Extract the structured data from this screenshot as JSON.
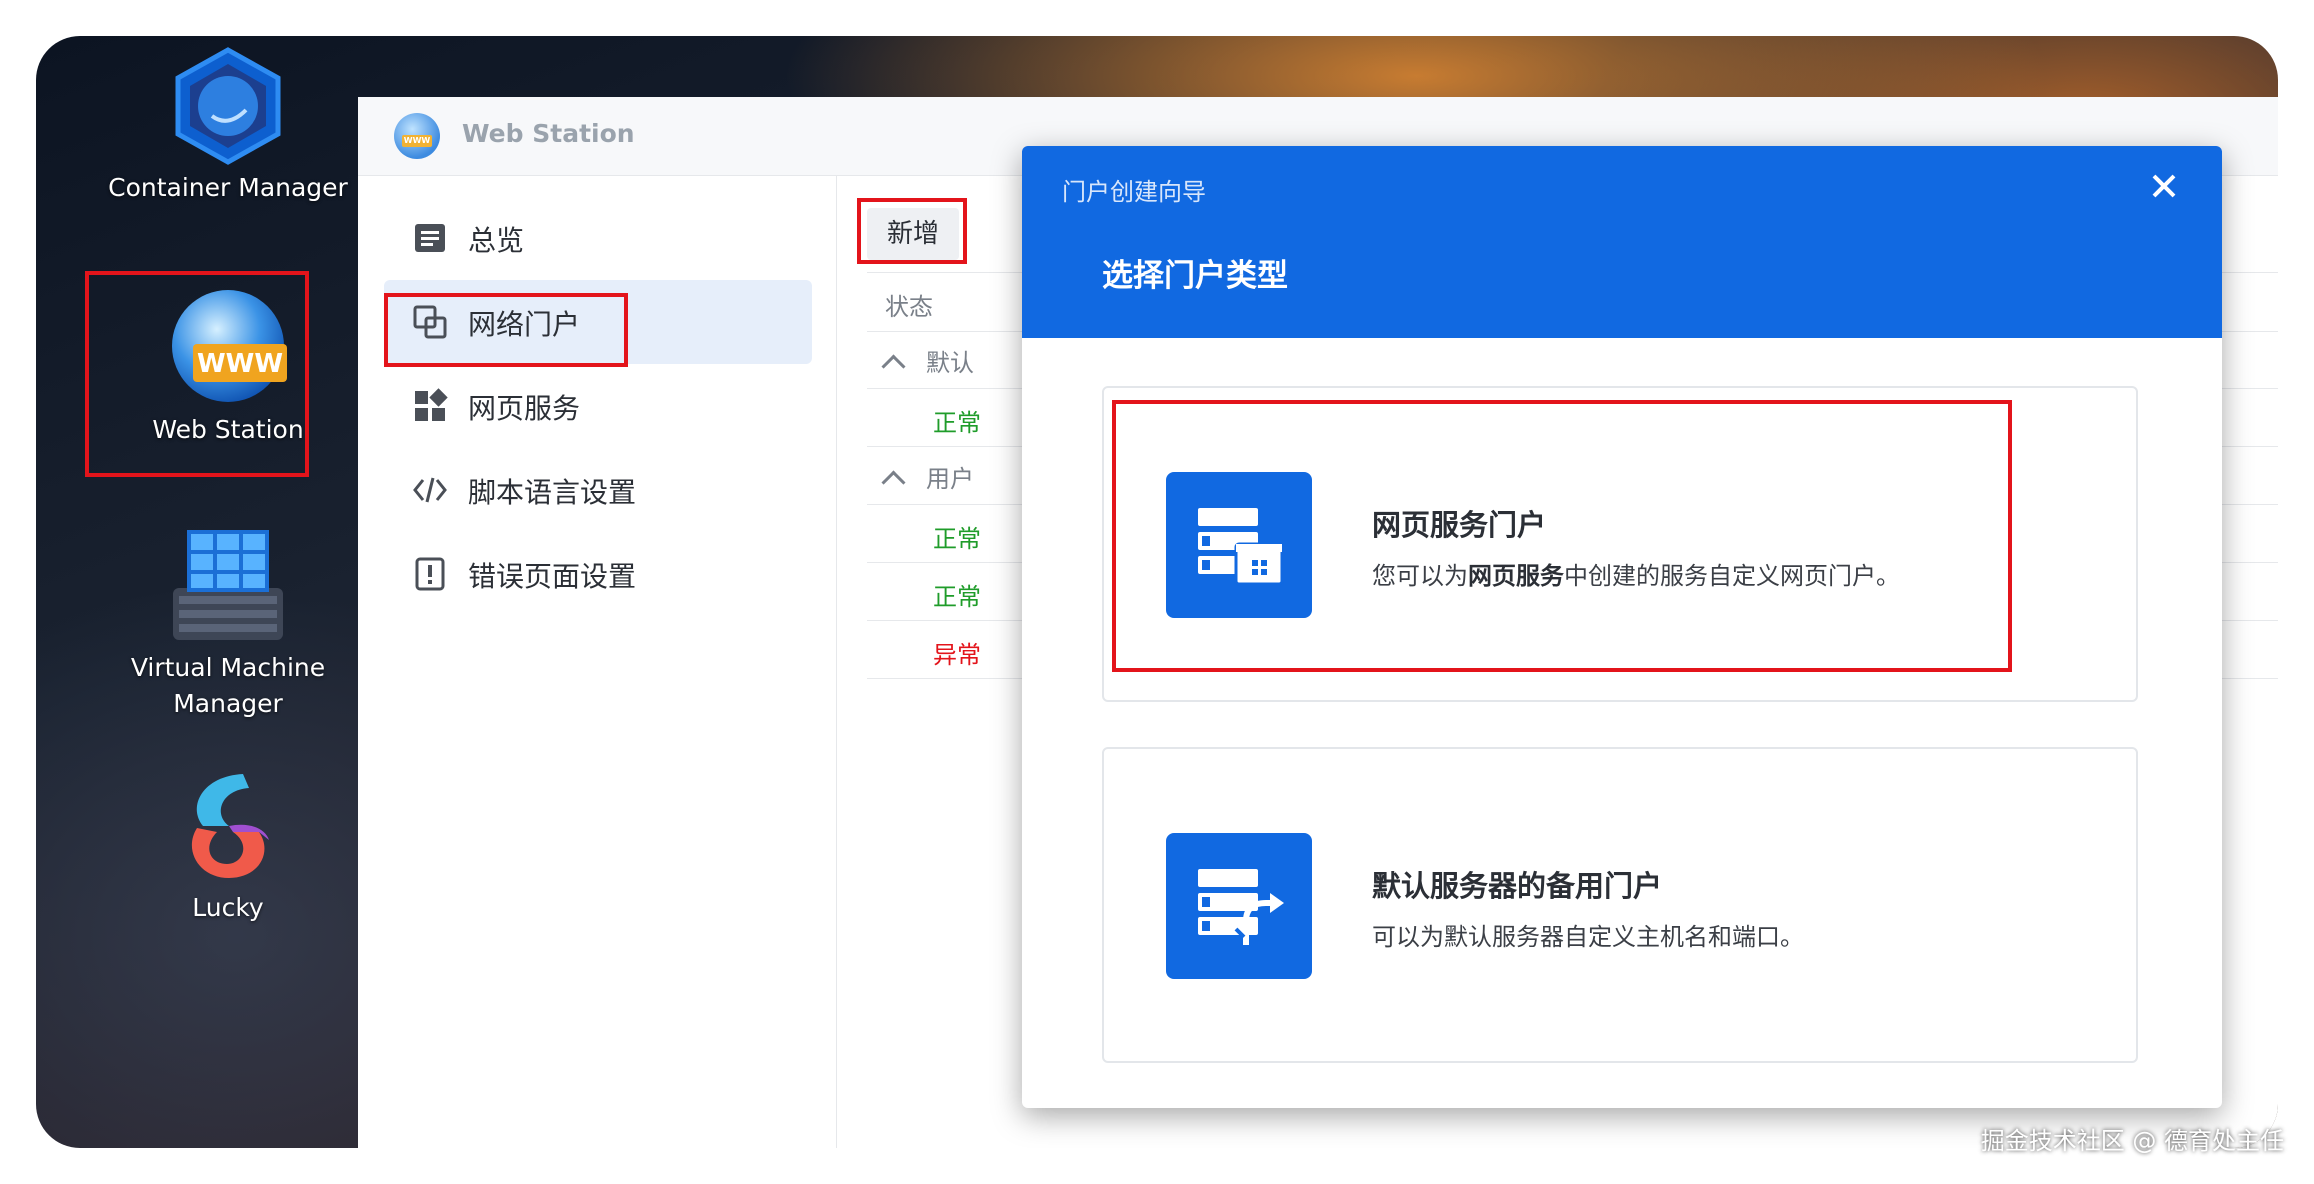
{
  "desktop": {
    "icons": [
      {
        "label": "Container Manager"
      },
      {
        "label": "Web Station"
      },
      {
        "label_line1": "Virtual Machine",
        "label_line2": "Manager"
      },
      {
        "label": "Lucky"
      }
    ]
  },
  "window": {
    "title": "Web Station",
    "logo_text": "WWW",
    "nav": [
      {
        "label": "总览",
        "icon": "overview-icon"
      },
      {
        "label": "网络门户",
        "icon": "portal-icon",
        "active": true
      },
      {
        "label": "网页服务",
        "icon": "grid-icon"
      },
      {
        "label": "脚本语言设置",
        "icon": "code-icon"
      },
      {
        "label": "错误页面设置",
        "icon": "error-page-icon"
      }
    ],
    "toolbar": {
      "add_label": "新增"
    },
    "table": {
      "status_header": "状态",
      "rows": [
        {
          "group": "默认"
        },
        {
          "status": "正常"
        },
        {
          "group": "用户"
        },
        {
          "status": "正常"
        },
        {
          "status": "正常"
        },
        {
          "status": "异常"
        }
      ]
    }
  },
  "modal": {
    "caption": "门户创建向导",
    "title": "选择门户类型",
    "options": [
      {
        "title": "网页服务门户",
        "desc_prefix": "您可以为",
        "desc_bold": "网页服务",
        "desc_suffix": "中创建的服务自定义网页门户。"
      },
      {
        "title": "默认服务器的备用门户",
        "desc": "可以为默认服务器自定义主机名和端口。"
      }
    ]
  },
  "watermark": "掘金技术社区 @ 德育处主任",
  "colors": {
    "accent": "#1169e1",
    "highlight": "#e3141b",
    "ok": "#1f9c2a",
    "error": "#e3141b"
  }
}
